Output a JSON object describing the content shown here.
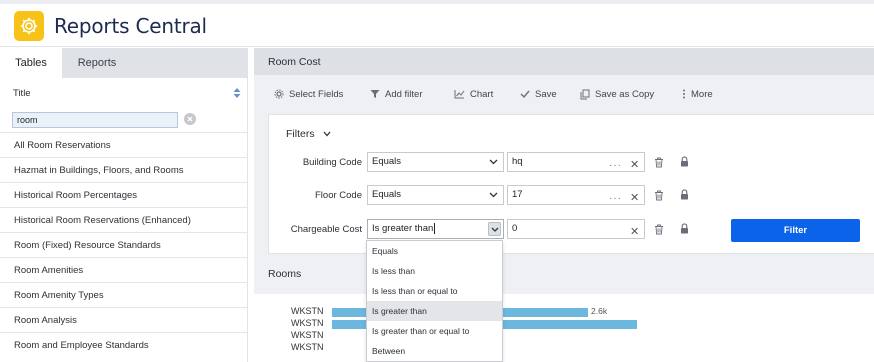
{
  "app": {
    "title": "Reports Central",
    "icon": "gear-icon"
  },
  "left_panel": {
    "tabs": [
      {
        "label": "Tables",
        "active": true
      },
      {
        "label": "Reports",
        "active": false
      }
    ],
    "column_title": "Title",
    "search": {
      "value": "room"
    },
    "items": [
      "All Room Reservations",
      "Hazmat in Buildings, Floors, and Rooms",
      "Historical Room Percentages",
      "Historical Room Reservations (Enhanced)",
      "Room (Fixed) Resource Standards",
      "Room Amenities",
      "Room Amenity Types",
      "Room Analysis",
      "Room and Employee Standards"
    ]
  },
  "main": {
    "title": "Room Cost",
    "toolbar": {
      "select_fields": "Select Fields",
      "add_filter": "Add filter",
      "chart": "Chart",
      "save": "Save",
      "save_as_copy": "Save as Copy",
      "more": "More"
    },
    "filters": {
      "title": "Filters",
      "rows": [
        {
          "label": "Building Code",
          "operator": "Equals",
          "value": "hq"
        },
        {
          "label": "Floor Code",
          "operator": "Equals",
          "value": "17"
        },
        {
          "label": "Chargeable Cost",
          "operator": "Is greater than",
          "value": "0"
        }
      ],
      "filter_button": "Filter"
    },
    "operator_options": [
      "Equals",
      "Is less than",
      "Is less than or equal to",
      "Is greater than",
      "Is greater than or equal to",
      "Between"
    ],
    "selected_option": "Is greater than",
    "rooms_title": "Rooms"
  },
  "chart_data": {
    "type": "bar",
    "orientation": "horizontal",
    "categories": [
      "WKSTN",
      "WKSTN",
      "WKSTN",
      "WKSTN"
    ],
    "values": [
      2600,
      3100,
      null,
      null
    ],
    "data_labels": [
      "2.6k",
      "",
      "",
      ""
    ],
    "colors": {
      "bar": "#6bb7dd"
    }
  },
  "colors": {
    "accent": "#0a63e8",
    "brand_icon": "#f7c318"
  }
}
